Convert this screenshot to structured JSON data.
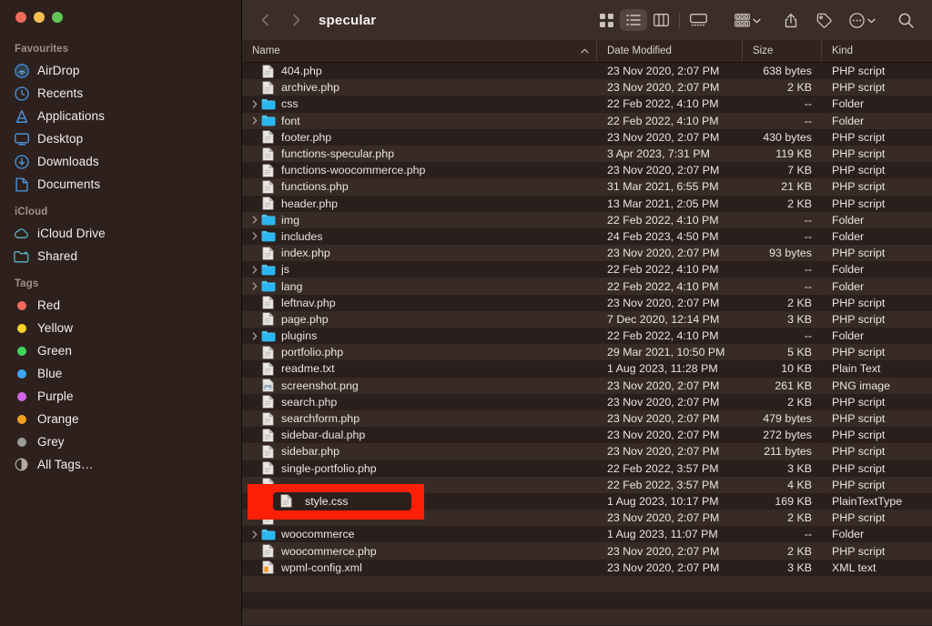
{
  "window": {
    "traffic_lights": [
      {
        "name": "close-button",
        "color": "#ed6a5e"
      },
      {
        "name": "minimize-button",
        "color": "#f5bf4f"
      },
      {
        "name": "maximize-button",
        "color": "#61c555"
      }
    ]
  },
  "sidebar": {
    "sections": [
      {
        "heading": "Favourites",
        "items": [
          {
            "label": "AirDrop",
            "icon": "airdrop-icon"
          },
          {
            "label": "Recents",
            "icon": "clock-icon"
          },
          {
            "label": "Applications",
            "icon": "applications-icon"
          },
          {
            "label": "Desktop",
            "icon": "desktop-icon"
          },
          {
            "label": "Downloads",
            "icon": "downloads-icon"
          },
          {
            "label": "Documents",
            "icon": "document-icon"
          }
        ]
      },
      {
        "heading": "iCloud",
        "items": [
          {
            "label": "iCloud Drive",
            "icon": "cloud-icon"
          },
          {
            "label": "Shared",
            "icon": "shared-folder-icon"
          }
        ]
      },
      {
        "heading": "Tags",
        "items": [
          {
            "label": "Red",
            "icon": "tag-dot-icon",
            "color": "#f2695e"
          },
          {
            "label": "Yellow",
            "icon": "tag-dot-icon",
            "color": "#f6d32b"
          },
          {
            "label": "Green",
            "icon": "tag-dot-icon",
            "color": "#3fd55a"
          },
          {
            "label": "Blue",
            "icon": "tag-dot-icon",
            "color": "#3da5f5"
          },
          {
            "label": "Purple",
            "icon": "tag-dot-icon",
            "color": "#d366e8"
          },
          {
            "label": "Orange",
            "icon": "tag-dot-icon",
            "color": "#f2a01c"
          },
          {
            "label": "Grey",
            "icon": "tag-dot-icon",
            "color": "#9b9b9b"
          },
          {
            "label": "All Tags…",
            "icon": "all-tags-icon",
            "color": "#b4a9a3"
          }
        ]
      }
    ]
  },
  "toolbar": {
    "back_label": "‹",
    "forward_label": "›",
    "path_title": "specular",
    "view_buttons": [
      {
        "name": "icon-view",
        "label": "icon-grid-icon",
        "active": false
      },
      {
        "name": "list-view",
        "label": "list-icon",
        "active": true
      },
      {
        "name": "column-view",
        "label": "columns-icon",
        "active": false
      },
      {
        "name": "gallery-view",
        "label": "gallery-icon",
        "active": false
      }
    ],
    "action_buttons": [
      {
        "name": "group-by-button",
        "label": "group-icon"
      },
      {
        "name": "share-button",
        "label": "share-icon"
      },
      {
        "name": "tag-button",
        "label": "tag-icon"
      },
      {
        "name": "more-actions-button",
        "label": "ellipsis-circle-icon"
      },
      {
        "name": "search-button",
        "label": "search-icon"
      }
    ]
  },
  "columns": {
    "name": "Name",
    "date_modified": "Date Modified",
    "size": "Size",
    "kind": "Kind",
    "sort_indicator": "⌃",
    "sorted_by": "Name",
    "sort_direction": "ascending"
  },
  "files": [
    {
      "name": "404.php",
      "date": "23 Nov 2020, 2:07 PM",
      "size": "638 bytes",
      "kind": "PHP script",
      "icon": "file-icon",
      "folder": false
    },
    {
      "name": "archive.php",
      "date": "23 Nov 2020, 2:07 PM",
      "size": "2 KB",
      "kind": "PHP script",
      "icon": "file-icon",
      "folder": false
    },
    {
      "name": "css",
      "date": "22 Feb 2022, 4:10 PM",
      "size": "--",
      "kind": "Folder",
      "icon": "folder-icon",
      "folder": true
    },
    {
      "name": "font",
      "date": "22 Feb 2022, 4:10 PM",
      "size": "--",
      "kind": "Folder",
      "icon": "folder-icon",
      "folder": true
    },
    {
      "name": "footer.php",
      "date": "23 Nov 2020, 2:07 PM",
      "size": "430 bytes",
      "kind": "PHP script",
      "icon": "file-icon",
      "folder": false
    },
    {
      "name": "functions-specular.php",
      "date": "3 Apr 2023, 7:31 PM",
      "size": "119 KB",
      "kind": "PHP script",
      "icon": "file-icon",
      "folder": false
    },
    {
      "name": "functions-woocommerce.php",
      "date": "23 Nov 2020, 2:07 PM",
      "size": "7 KB",
      "kind": "PHP script",
      "icon": "file-icon",
      "folder": false
    },
    {
      "name": "functions.php",
      "date": "31 Mar 2021, 6:55 PM",
      "size": "21 KB",
      "kind": "PHP script",
      "icon": "file-icon",
      "folder": false
    },
    {
      "name": "header.php",
      "date": "13 Mar 2021, 2:05 PM",
      "size": "2 KB",
      "kind": "PHP script",
      "icon": "file-icon",
      "folder": false
    },
    {
      "name": "img",
      "date": "22 Feb 2022, 4:10 PM",
      "size": "--",
      "kind": "Folder",
      "icon": "folder-icon",
      "folder": true
    },
    {
      "name": "includes",
      "date": "24 Feb 2023, 4:50 PM",
      "size": "--",
      "kind": "Folder",
      "icon": "folder-icon",
      "folder": true
    },
    {
      "name": "index.php",
      "date": "23 Nov 2020, 2:07 PM",
      "size": "93 bytes",
      "kind": "PHP script",
      "icon": "file-icon",
      "folder": false
    },
    {
      "name": "js",
      "date": "22 Feb 2022, 4:10 PM",
      "size": "--",
      "kind": "Folder",
      "icon": "folder-icon",
      "folder": true
    },
    {
      "name": "lang",
      "date": "22 Feb 2022, 4:10 PM",
      "size": "--",
      "kind": "Folder",
      "icon": "folder-icon",
      "folder": true
    },
    {
      "name": "leftnav.php",
      "date": "23 Nov 2020, 2:07 PM",
      "size": "2 KB",
      "kind": "PHP script",
      "icon": "file-icon",
      "folder": false
    },
    {
      "name": "page.php",
      "date": "7 Dec 2020, 12:14 PM",
      "size": "3 KB",
      "kind": "PHP script",
      "icon": "file-icon",
      "folder": false
    },
    {
      "name": "plugins",
      "date": "22 Feb 2022, 4:10 PM",
      "size": "--",
      "kind": "Folder",
      "icon": "folder-icon",
      "folder": true
    },
    {
      "name": "portfolio.php",
      "date": "29 Mar 2021, 10:50 PM",
      "size": "5 KB",
      "kind": "PHP script",
      "icon": "file-icon",
      "folder": false
    },
    {
      "name": "readme.txt",
      "date": "1 Aug 2023, 11:28 PM",
      "size": "10 KB",
      "kind": "Plain Text",
      "icon": "file-icon",
      "folder": false
    },
    {
      "name": "screenshot.png",
      "date": "23 Nov 2020, 2:07 PM",
      "size": "261 KB",
      "kind": "PNG image",
      "icon": "image-icon",
      "folder": false
    },
    {
      "name": "search.php",
      "date": "23 Nov 2020, 2:07 PM",
      "size": "2 KB",
      "kind": "PHP script",
      "icon": "file-icon",
      "folder": false
    },
    {
      "name": "searchform.php",
      "date": "23 Nov 2020, 2:07 PM",
      "size": "479 bytes",
      "kind": "PHP script",
      "icon": "file-icon",
      "folder": false
    },
    {
      "name": "sidebar-dual.php",
      "date": "23 Nov 2020, 2:07 PM",
      "size": "272 bytes",
      "kind": "PHP script",
      "icon": "file-icon",
      "folder": false
    },
    {
      "name": "sidebar.php",
      "date": "23 Nov 2020, 2:07 PM",
      "size": "211 bytes",
      "kind": "PHP script",
      "icon": "file-icon",
      "folder": false
    },
    {
      "name": "single-portfolio.php",
      "date": "22 Feb 2022, 3:57 PM",
      "size": "3 KB",
      "kind": "PHP script",
      "icon": "file-icon",
      "folder": false
    },
    {
      "name": "",
      "date": "22 Feb 2022, 3:57 PM",
      "size": "4 KB",
      "kind": "PHP script",
      "icon": "file-icon",
      "folder": false
    },
    {
      "name": "style.css",
      "date": "1 Aug 2023, 10:17 PM",
      "size": "169 KB",
      "kind": "PlainTextType",
      "icon": "file-icon",
      "folder": false
    },
    {
      "name": "",
      "date": "23 Nov 2020, 2:07 PM",
      "size": "2 KB",
      "kind": "PHP script",
      "icon": "file-icon",
      "folder": false
    },
    {
      "name": "woocommerce",
      "date": "1 Aug 2023, 11:07 PM",
      "size": "--",
      "kind": "Folder",
      "icon": "folder-icon",
      "folder": true
    },
    {
      "name": "woocommerce.php",
      "date": "23 Nov 2020, 2:07 PM",
      "size": "2 KB",
      "kind": "PHP script",
      "icon": "file-icon",
      "folder": false
    },
    {
      "name": "wpml-config.xml",
      "date": "23 Nov 2020, 2:07 PM",
      "size": "3 KB",
      "kind": "XML text",
      "icon": "xml-icon",
      "folder": false
    }
  ],
  "annotation": {
    "highlighted_file": "style.css",
    "color": "#fc1f07"
  }
}
